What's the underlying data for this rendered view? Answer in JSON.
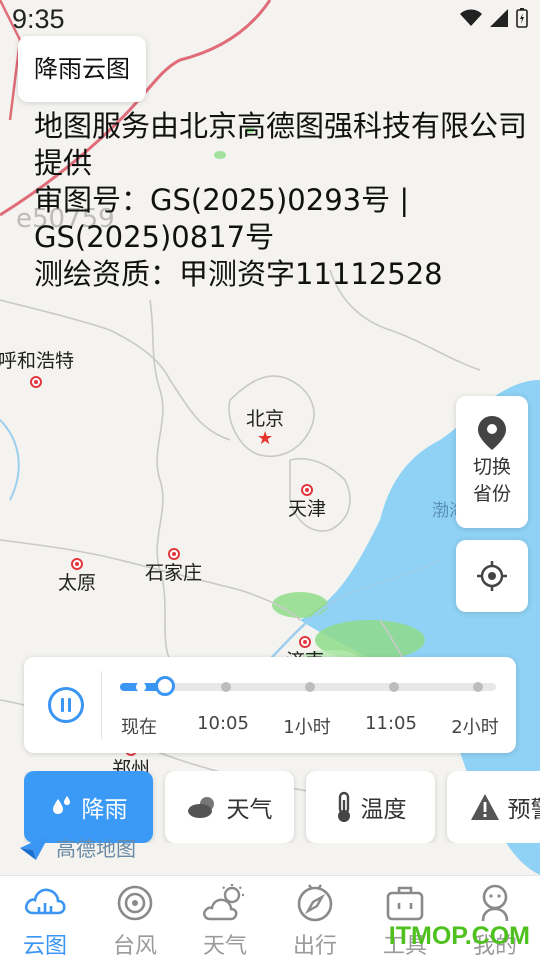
{
  "status_bar": {
    "time": "9:35",
    "icons": [
      "wifi-icon",
      "signal-icon",
      "battery-icon"
    ]
  },
  "title_chip": {
    "label": "降雨云图"
  },
  "map": {
    "credit_text": "地图服务由北京高德图强科技有限公司提供\n审图号：GS(2025)0293号 | GS(2025)0817号\n测绘资质：甲测资字11112528",
    "watermark": "e50759",
    "cities": {
      "hohhot": "呼和浩特",
      "beijing": "北京",
      "tianjin": "天津",
      "taiyuan": "太原",
      "shijiazhuang": "石家庄",
      "jinan": "济南",
      "zhengzhou": "郑州"
    },
    "sea_label": "渤海",
    "logo_text": "高德地图",
    "colors": {
      "land": "#f4f3ef",
      "sea": "#8fd2f5",
      "rain": "#8fdc8a",
      "border": "#e06c78"
    }
  },
  "side_buttons": {
    "switch_province": "切换省份",
    "switch_icon": "location-pin-icon",
    "locate_icon": "locate-icon"
  },
  "timeline": {
    "play_state": "paused",
    "progress_fraction": 0.12,
    "labels": [
      "现在",
      "10:05",
      "1小时",
      "11:05",
      "2小时"
    ],
    "accent_color": "#3b95f2"
  },
  "layers": {
    "rain": "降雨",
    "weather": "天气",
    "temperature": "温度",
    "warning": "预警",
    "active": "rain"
  },
  "bottom_nav": {
    "items": [
      {
        "label": "云图",
        "icon": "cloud-radar-icon",
        "active": true
      },
      {
        "label": "台风",
        "icon": "typhoon-icon",
        "active": false
      },
      {
        "label": "天气",
        "icon": "weather-icon",
        "active": false
      },
      {
        "label": "出行",
        "icon": "compass-icon",
        "active": false
      },
      {
        "label": "工具",
        "icon": "toolbox-icon",
        "active": false
      },
      {
        "label": "我的",
        "icon": "profile-icon",
        "active": false
      }
    ]
  },
  "site_watermark": "ITMOP.COM"
}
